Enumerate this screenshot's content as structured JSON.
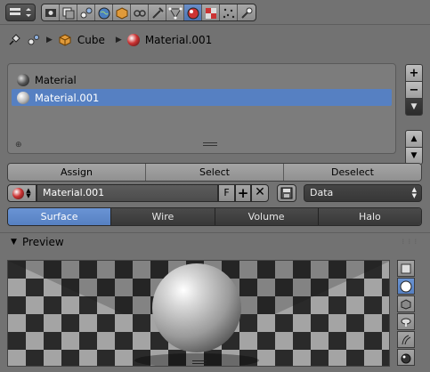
{
  "header": {
    "editor_type_icon": "properties-editor-icon",
    "tabs": [
      {
        "name": "render-icon",
        "active": false
      },
      {
        "name": "render-layers-icon",
        "active": false
      },
      {
        "name": "scene-icon",
        "active": false
      },
      {
        "name": "world-icon",
        "active": false
      },
      {
        "name": "object-icon",
        "active": false
      },
      {
        "name": "constraints-icon",
        "active": false
      },
      {
        "name": "modifiers-icon",
        "active": false
      },
      {
        "name": "data-icon",
        "active": false
      },
      {
        "name": "material-icon",
        "active": true
      },
      {
        "name": "texture-icon",
        "active": false
      },
      {
        "name": "particles-icon",
        "active": false
      },
      {
        "name": "physics-icon",
        "active": false
      }
    ]
  },
  "breadcrumb": {
    "object": "Cube",
    "material": "Material.001"
  },
  "material_slots": {
    "items": [
      {
        "label": "Material",
        "selected": false
      },
      {
        "label": "Material.001",
        "selected": true
      }
    ]
  },
  "actions": {
    "assign": "Assign",
    "select": "Select",
    "deselect": "Deselect"
  },
  "material_selector": {
    "name": "Material.001",
    "fake_user": "F",
    "link_dropdown": "Data"
  },
  "shading_tabs": {
    "surface": "Surface",
    "wire": "Wire",
    "volume": "Volume",
    "halo": "Halo"
  },
  "preview_panel": {
    "title": "Preview",
    "tools": [
      "plane-preview-icon",
      "sphere-preview-icon",
      "cube-preview-icon",
      "monkey-preview-icon",
      "hair-preview-icon",
      "sphere-sky-preview-icon"
    ],
    "active_tool": 1
  },
  "colors": {
    "accent": "#5680c2",
    "panel_bg": "#727272"
  }
}
